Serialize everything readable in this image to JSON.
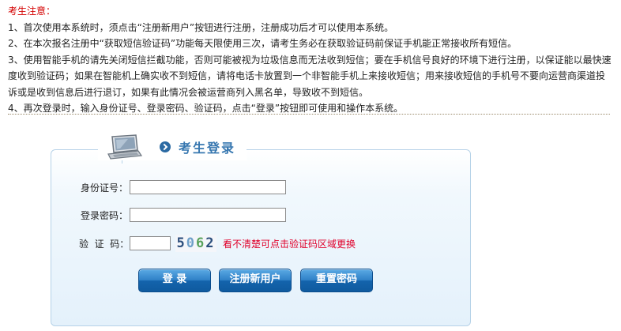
{
  "notice": {
    "title": "考生注意：",
    "items": [
      "1、首次使用本系统时，须点击“注册新用户”按钮进行注册，注册成功后才可以使用本系统。",
      "2、在本次报名注册中“获取短信验证码”功能每天限使用三次，请考生务必在获取验证码前保证手机能正常接收所有短信。",
      "3、使用智能手机的请先关闭短信拦截功能，否则可能被视为垃圾信息而无法收到短信；要在手机信号良好的环境下进行注册，以保证能以最快速度收到验证码；如果在智能机上确实收不到短信，请将电话卡放置到一个非智能手机上来接收短信；用来接收短信的手机号不要向运营商渠道投诉或是收到信息后进行退订，如果有此情况会被运营商列入黑名单，导致收不到短信。",
      "4、再次登录时，输入身份证号、登录密码、验证码，点击“登录”按钮即可使用和操作本系统。"
    ]
  },
  "login": {
    "title": "考生登录",
    "id_label": "身份证号：",
    "id_value": "",
    "password_label": "登录密码：",
    "password_value": "",
    "captcha_label": "验  证  码：",
    "captcha_value": "",
    "captcha_digits": [
      "5",
      "0",
      "6",
      "2"
    ],
    "captcha_hint": "看不清楚可点击验证码区域更换"
  },
  "buttons": {
    "login": "登 录",
    "register": "注册新用户",
    "reset": "重置密码"
  },
  "colors": {
    "notice_title": "#d40000",
    "hint": "#e0002a",
    "button": "#1a6bb3",
    "panel_border": "#b6d2e8"
  },
  "icons": {
    "header": "laptop-icon",
    "bullet": "circle-arrow-icon"
  }
}
